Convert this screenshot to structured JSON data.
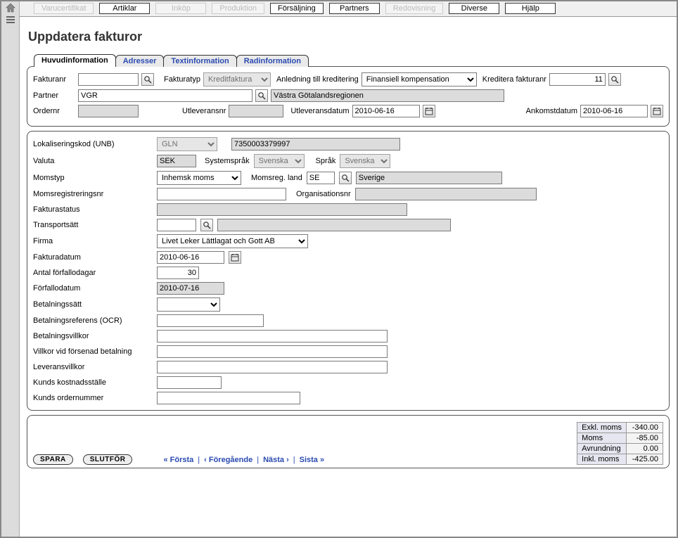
{
  "menubar": {
    "items": [
      {
        "label": "Varucertifikat",
        "disabled": true
      },
      {
        "label": "Artiklar",
        "disabled": false
      },
      {
        "label": "Inköp",
        "disabled": true
      },
      {
        "label": "Produktion",
        "disabled": true
      },
      {
        "label": "Försäljning",
        "disabled": false
      },
      {
        "label": "Partners",
        "disabled": false
      },
      {
        "label": "Redovisning",
        "disabled": true
      },
      {
        "label": "Diverse",
        "disabled": false
      },
      {
        "label": "Hjälp",
        "disabled": false
      }
    ]
  },
  "page_title": "Uppdatera fakturor",
  "tabs": {
    "items": [
      {
        "label": "Huvudinformation",
        "active": true
      },
      {
        "label": "Adresser",
        "active": false
      },
      {
        "label": "Textinformation",
        "active": false
      },
      {
        "label": "Radinformation",
        "active": false
      }
    ]
  },
  "top": {
    "fakturanr_label": "Fakturanr",
    "fakturanr": "",
    "fakturatyp_label": "Fakturatyp",
    "fakturatyp": "Kreditfaktura",
    "anledning_label": "Anledning till kreditering",
    "anledning": "Finansiell kompensation",
    "kreditera_label": "Kreditera fakturanr",
    "kreditera": "11",
    "partner_label": "Partner",
    "partner_code": "VGR",
    "partner_name": "Västra Götalandsregionen",
    "ordernr_label": "Ordernr",
    "ordernr": "",
    "utleveransnr_label": "Utleveransnr",
    "utleveransnr": "",
    "utleveransdatum_label": "Utleveransdatum",
    "utleveransdatum": "2010-06-16",
    "ankomstdatum_label": "Ankomstdatum",
    "ankomstdatum": "2010-06-16"
  },
  "main": {
    "lokaliseringskod_label": "Lokaliseringskod (UNB)",
    "lokaliseringskod_type": "GLN",
    "lokaliseringskod": "7350003379997",
    "valuta_label": "Valuta",
    "valuta": "SEK",
    "systemsprak_label": "Systemspråk",
    "systemsprak": "Svenska",
    "sprak_label": "Språk",
    "sprak": "Svenska",
    "momstyp_label": "Momstyp",
    "momstyp": "Inhemsk moms",
    "momsregland_label": "Momsreg. land",
    "momsregland_code": "SE",
    "momsregland_name": "Sverige",
    "momsregnr_label": "Momsregistreringsnr",
    "momsregnr": "",
    "orgnr_label": "Organisationsnr",
    "orgnr": "",
    "fakturastatus_label": "Fakturastatus",
    "fakturastatus": "",
    "transportsatt_label": "Transportsätt",
    "transportsatt_code": "",
    "transportsatt_name": "",
    "firma_label": "Firma",
    "firma": "Livet Leker Lättlagat och Gott AB",
    "fakturadatum_label": "Fakturadatum",
    "fakturadatum": "2010-06-16",
    "antal_forfallodagar_label": "Antal förfallodagar",
    "antal_forfallodagar": "30",
    "forfallodatum_label": "Förfallodatum",
    "forfallodatum": "2010-07-16",
    "betalningssatt_label": "Betalningssätt",
    "betalningssatt": "",
    "ocr_label": "Betalningsreferens (OCR)",
    "ocr": "",
    "betalningsvillkor_label": "Betalningsvillkor",
    "betalningsvillkor": "",
    "forsenad_label": "Villkor vid försenad betalning",
    "forsenad": "",
    "leveransvillkor_label": "Leveransvillkor",
    "leveransvillkor": "",
    "kostnadsstalle_label": "Kunds kostnadsställe",
    "kostnadsstalle": "",
    "kunds_ordernr_label": "Kunds ordernummer",
    "kunds_ordernr": ""
  },
  "actions": {
    "save": "SPARA",
    "finish": "SLUTFÖR",
    "first": "« Första",
    "prev": "‹ Föregående",
    "next": "Nästa ›",
    "last": "Sista »"
  },
  "totals": {
    "exkl_label": "Exkl. moms",
    "exkl": "-340.00",
    "moms_label": "Moms",
    "moms": "-85.00",
    "avrund_label": "Avrundning",
    "avrund": "0.00",
    "inkl_label": "Inkl. moms",
    "inkl": "-425.00"
  }
}
